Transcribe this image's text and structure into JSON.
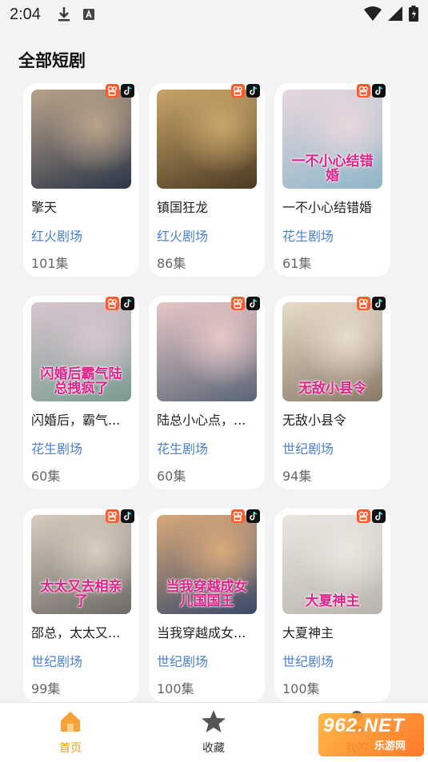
{
  "status_bar": {
    "time": "2:04"
  },
  "section_title": "全部短剧",
  "dramas": [
    {
      "title": "擎天",
      "source": "红火剧场",
      "episodes": "101集",
      "caption": "",
      "bg1": "#2b3548",
      "bg2": "#b9a38a"
    },
    {
      "title": "镇国狂龙",
      "source": "红火剧场",
      "episodes": "86集",
      "caption": "",
      "bg1": "#4a3a22",
      "bg2": "#c9a56a"
    },
    {
      "title": "一不小心结错婚",
      "source": "花生剧场",
      "episodes": "61集",
      "caption": "一不小心结错婚",
      "bg1": "#8fb6c8",
      "bg2": "#e9d7dd"
    },
    {
      "title": "闪婚后，霸气...",
      "source": "花生剧场",
      "episodes": "60集",
      "caption": "闪婚后霸气陆总拽疯了",
      "bg1": "#7a9b92",
      "bg2": "#d9c6cf"
    },
    {
      "title": "陆总小心点，...",
      "source": "花生剧场",
      "episodes": "60集",
      "caption": "",
      "bg1": "#5a6577",
      "bg2": "#e7c7c7"
    },
    {
      "title": "无敌小县令",
      "source": "世纪剧场",
      "episodes": "94集",
      "caption": "无敌小县令",
      "bg1": "#8a7a6a",
      "bg2": "#e8dccb"
    },
    {
      "title": "邵总，太太又...",
      "source": "世纪剧场",
      "episodes": "99集",
      "caption": "太太又去相亲了",
      "bg1": "#6e6a66",
      "bg2": "#d8ccbf"
    },
    {
      "title": "当我穿越成女...",
      "source": "世纪剧场",
      "episodes": "100集",
      "caption": "当我穿越成女儿国国王",
      "bg1": "#3a4a6a",
      "bg2": "#d9a97a"
    },
    {
      "title": "大夏神主",
      "source": "世纪剧场",
      "episodes": "100集",
      "caption": "大夏神主",
      "bg1": "#b9b3ad",
      "bg2": "#eae6e1"
    }
  ],
  "bottom_nav": [
    {
      "label": "首页",
      "icon": "home-icon",
      "active": true
    },
    {
      "label": "收藏",
      "icon": "star-icon",
      "active": false
    },
    {
      "label": "我的",
      "icon": "profile-icon",
      "active": false
    }
  ],
  "watermark": {
    "top": "962.NET",
    "bottom": "乐游网"
  },
  "colors": {
    "accent": "#f09a2a",
    "source_link": "#4a7fd0",
    "badge": "#ff5a2a"
  }
}
